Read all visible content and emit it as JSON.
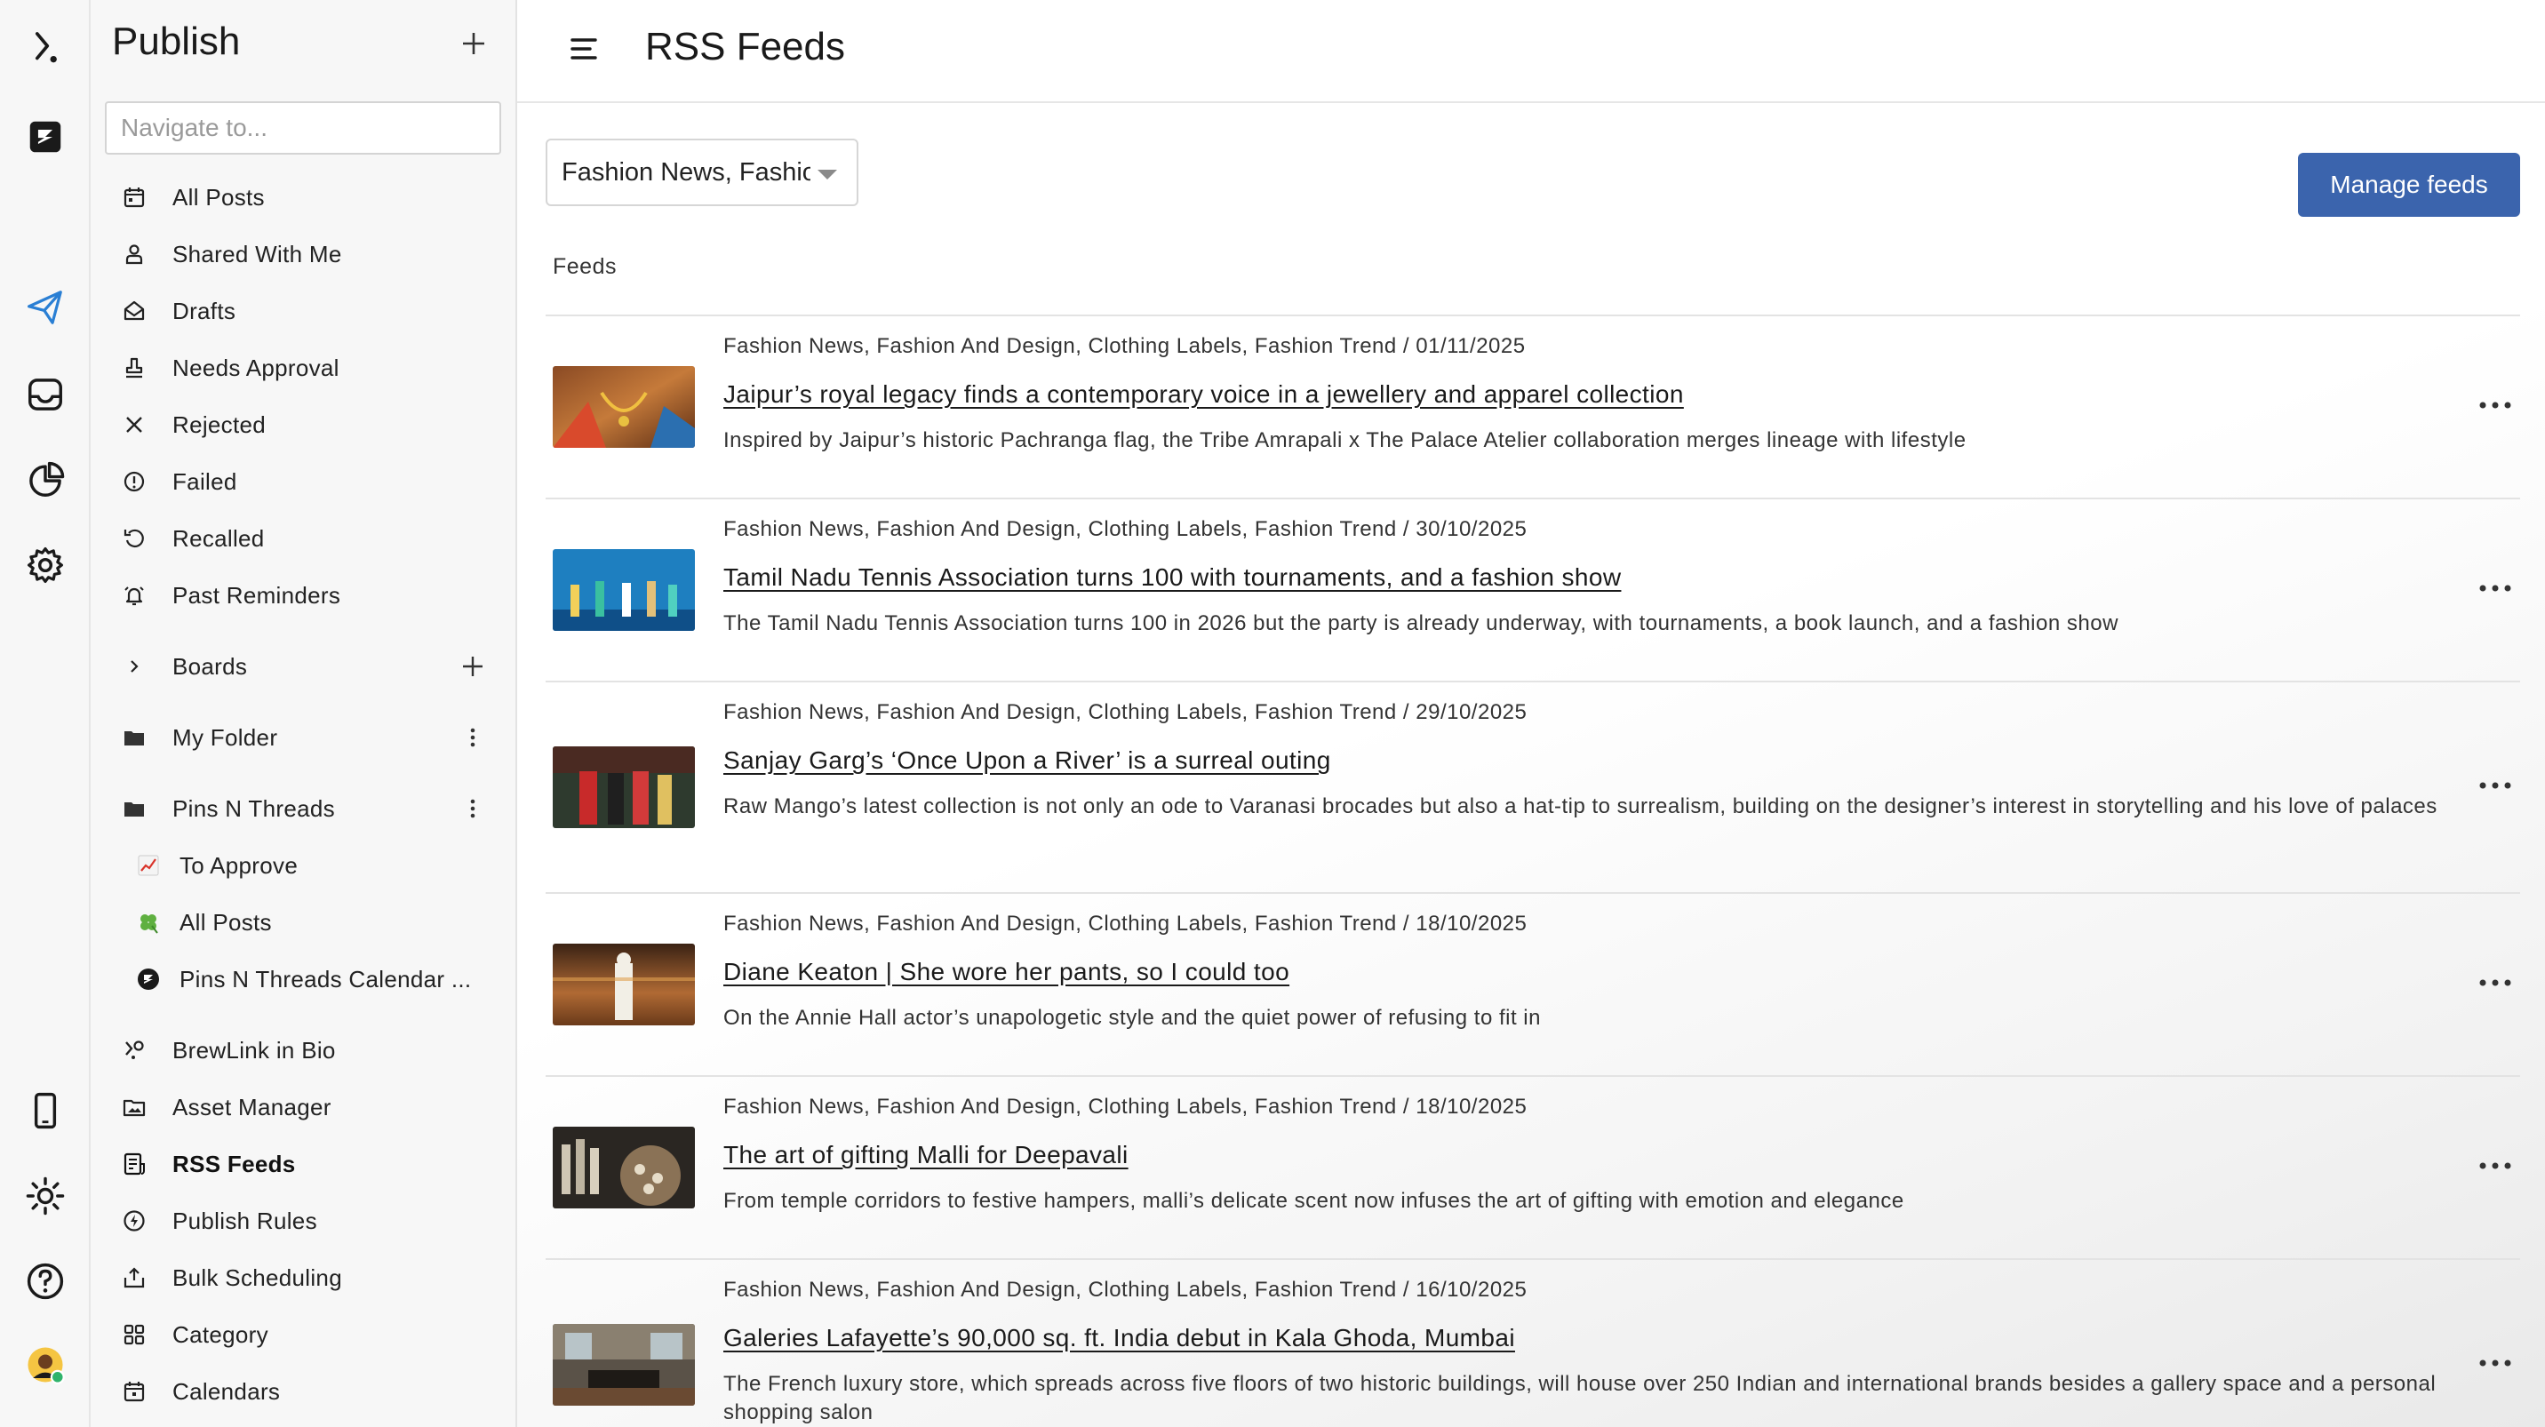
{
  "sidebar": {
    "title": "Publish",
    "search_placeholder": "Navigate to...",
    "items": [
      {
        "label": "All Posts"
      },
      {
        "label": "Shared With Me"
      },
      {
        "label": "Drafts"
      },
      {
        "label": "Needs Approval"
      },
      {
        "label": "Rejected"
      },
      {
        "label": "Failed"
      },
      {
        "label": "Recalled"
      },
      {
        "label": "Past Reminders"
      },
      {
        "label": "Boards"
      },
      {
        "label": "My Folder"
      },
      {
        "label": "Pins N Threads"
      },
      {
        "label": "To Approve"
      },
      {
        "label": "All Posts"
      },
      {
        "label": "Pins N Threads Calendar ..."
      },
      {
        "label": "BrewLink in Bio"
      },
      {
        "label": "Asset Manager"
      },
      {
        "label": "RSS Feeds"
      },
      {
        "label": "Publish Rules"
      },
      {
        "label": "Bulk Scheduling"
      },
      {
        "label": "Category"
      },
      {
        "label": "Calendars"
      }
    ]
  },
  "header": {
    "title": "RSS Feeds"
  },
  "main": {
    "selected_feed": "Fashion News, Fashion And Design, Clothing Labels, Fashion Trend",
    "manage_label": "Manage feeds",
    "feeds_label": "Feeds",
    "feeds": [
      {
        "meta": "Fashion News, Fashion And Design, Clothing Labels, Fashion Trend / 01/11/2025",
        "title": "Jaipur’s royal legacy finds a contemporary voice in a jewellery and apparel collection",
        "desc": "Inspired by Jaipur’s historic Pachranga flag, the Tribe Amrapali x The Palace Atelier collaboration merges lineage with lifestyle"
      },
      {
        "meta": "Fashion News, Fashion And Design, Clothing Labels, Fashion Trend / 30/10/2025",
        "title": "Tamil Nadu Tennis Association turns 100 with tournaments, and a fashion show",
        "desc": "The Tamil Nadu Tennis Association turns 100 in 2026 but the party is already underway, with tournaments, a book launch, and a fashion show"
      },
      {
        "meta": "Fashion News, Fashion And Design, Clothing Labels, Fashion Trend / 29/10/2025",
        "title": "Sanjay Garg’s ‘Once Upon a River’ is a surreal outing",
        "desc": "Raw Mango’s latest collection is not only an ode to Varanasi brocades but also a hat-tip to surrealism, building on the designer’s interest in storytelling and his love of palaces"
      },
      {
        "meta": "Fashion News, Fashion And Design, Clothing Labels, Fashion Trend / 18/10/2025",
        "title": "Diane Keaton | She wore her pants, so I could too",
        "desc": "On the Annie Hall actor’s unapologetic style and the quiet power of refusing to fit in"
      },
      {
        "meta": "Fashion News, Fashion And Design, Clothing Labels, Fashion Trend / 18/10/2025",
        "title": "The art of gifting Malli for Deepavali",
        "desc": "From temple corridors to festive hampers, malli’s delicate scent now infuses the art of gifting with emotion and elegance"
      },
      {
        "meta": "Fashion News, Fashion And Design, Clothing Labels, Fashion Trend / 16/10/2025",
        "title": "Galeries Lafayette’s 90,000 sq. ft. India debut in Kala Ghoda, Mumbai",
        "desc": "The French luxury store, which spreads across five floors of two historic buildings, will house over 250 Indian and international brands besides a gallery space and a personal shopping salon"
      }
    ]
  },
  "colors": {
    "accent": "#3b64ad",
    "rail_active": "#2a7fd4"
  }
}
